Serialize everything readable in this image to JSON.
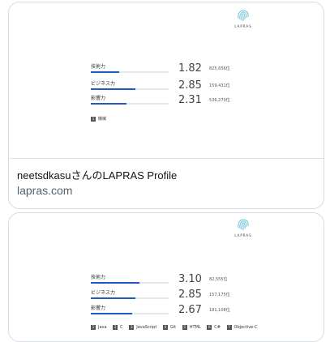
{
  "logo_text": "LAPRAS",
  "cards": [
    {
      "title": "neetsdkasuさんのLAPRAS Profile",
      "domain": "lapras.com",
      "metrics": [
        {
          "label": "技術力",
          "score": "1.82",
          "rank": "825,656位",
          "fill": 0.36
        },
        {
          "label": "ビジネス力",
          "score": "2.85",
          "rank": "159,431位",
          "fill": 0.57
        },
        {
          "label": "影響力",
          "score": "2.31",
          "rank": "536,270位",
          "fill": 0.46
        }
      ],
      "tags": [
        {
          "num": "1",
          "text": "機械"
        }
      ]
    },
    {
      "metrics": [
        {
          "label": "技術力",
          "score": "3.10",
          "rank": "82,555位",
          "fill": 0.62
        },
        {
          "label": "ビジネス力",
          "score": "2.85",
          "rank": "157,175位",
          "fill": 0.57
        },
        {
          "label": "影響力",
          "score": "2.67",
          "rank": "181,108位",
          "fill": 0.53
        }
      ],
      "tags": [
        {
          "num": "1",
          "text": "Java"
        },
        {
          "num": "2",
          "text": "C"
        },
        {
          "num": "3",
          "text": "JavaScript"
        },
        {
          "num": "4",
          "text": "Git"
        },
        {
          "num": "5",
          "text": "HTML"
        },
        {
          "num": "6",
          "text": "C#"
        },
        {
          "num": "7",
          "text": "Objective-C"
        }
      ]
    }
  ]
}
